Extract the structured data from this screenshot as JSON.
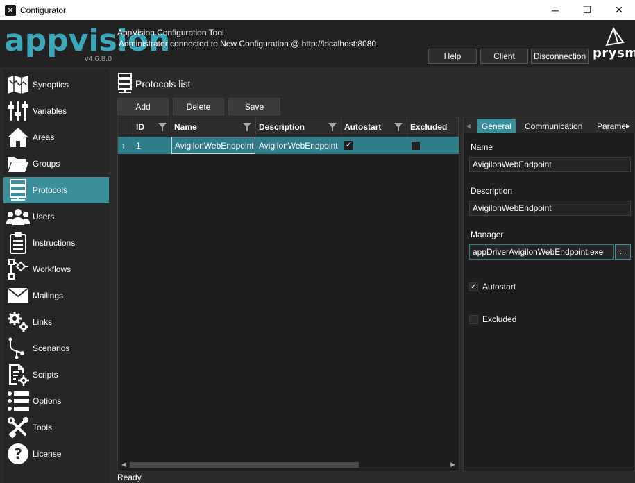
{
  "window": {
    "title": "Configurator",
    "minimize": "─",
    "maximize": "☐",
    "close": "✕"
  },
  "header": {
    "logo": "appvision",
    "version": "v4.6.8.0",
    "title": "AppVision Configuration Tool",
    "subtitle": "Administrator connected to New Configuration @ http://localhost:8080",
    "buttons": {
      "help": "Help",
      "client": "Client",
      "disconnection": "Disconnection"
    },
    "brand": "prysm"
  },
  "sidebar": {
    "items": [
      {
        "label": "Synoptics",
        "icon": "map-icon"
      },
      {
        "label": "Variables",
        "icon": "sliders-icon"
      },
      {
        "label": "Areas",
        "icon": "home-icon"
      },
      {
        "label": "Groups",
        "icon": "folder-icon"
      },
      {
        "label": "Protocols",
        "icon": "server-icon",
        "active": true
      },
      {
        "label": "Users",
        "icon": "users-icon"
      },
      {
        "label": "Instructions",
        "icon": "clipboard-icon"
      },
      {
        "label": "Workflows",
        "icon": "workflow-icon"
      },
      {
        "label": "Mailings",
        "icon": "mail-icon"
      },
      {
        "label": "Links",
        "icon": "gears-icon"
      },
      {
        "label": "Scenarios",
        "icon": "scenario-icon"
      },
      {
        "label": "Scripts",
        "icon": "script-icon"
      },
      {
        "label": "Options",
        "icon": "list-icon"
      },
      {
        "label": "Tools",
        "icon": "tools-icon"
      },
      {
        "label": "License",
        "icon": "help-circle-icon"
      }
    ]
  },
  "main": {
    "page_title": "Protocols list",
    "toolbar": {
      "add": "Add",
      "delete": "Delete",
      "save": "Save"
    },
    "grid": {
      "columns": [
        "ID",
        "Name",
        "Description",
        "Autostart",
        "Excluded"
      ],
      "rows": [
        {
          "selector": "›",
          "id": "1",
          "name": "AvigilonWebEndpoint",
          "description": "AvigilonWebEndpoint",
          "autostart": true,
          "excluded": false
        }
      ]
    }
  },
  "panel": {
    "tabs": [
      "General",
      "Communication",
      "Parame"
    ],
    "active_tab": "General",
    "name_label": "Name",
    "name_value": "AvigilonWebEndpoint",
    "description_label": "Description",
    "description_value": "AvigilonWebEndpoint",
    "manager_label": "Manager",
    "manager_value": "appDriverAvigilonWebEndpoint.exe",
    "browse": "...",
    "autostart_label": "Autostart",
    "autostart": true,
    "excluded_label": "Excluded",
    "excluded": false
  },
  "status": "Ready",
  "colors": {
    "accent": "#3b8f9a",
    "logo": "#3aa8b8",
    "background": "#2b2b2b"
  }
}
